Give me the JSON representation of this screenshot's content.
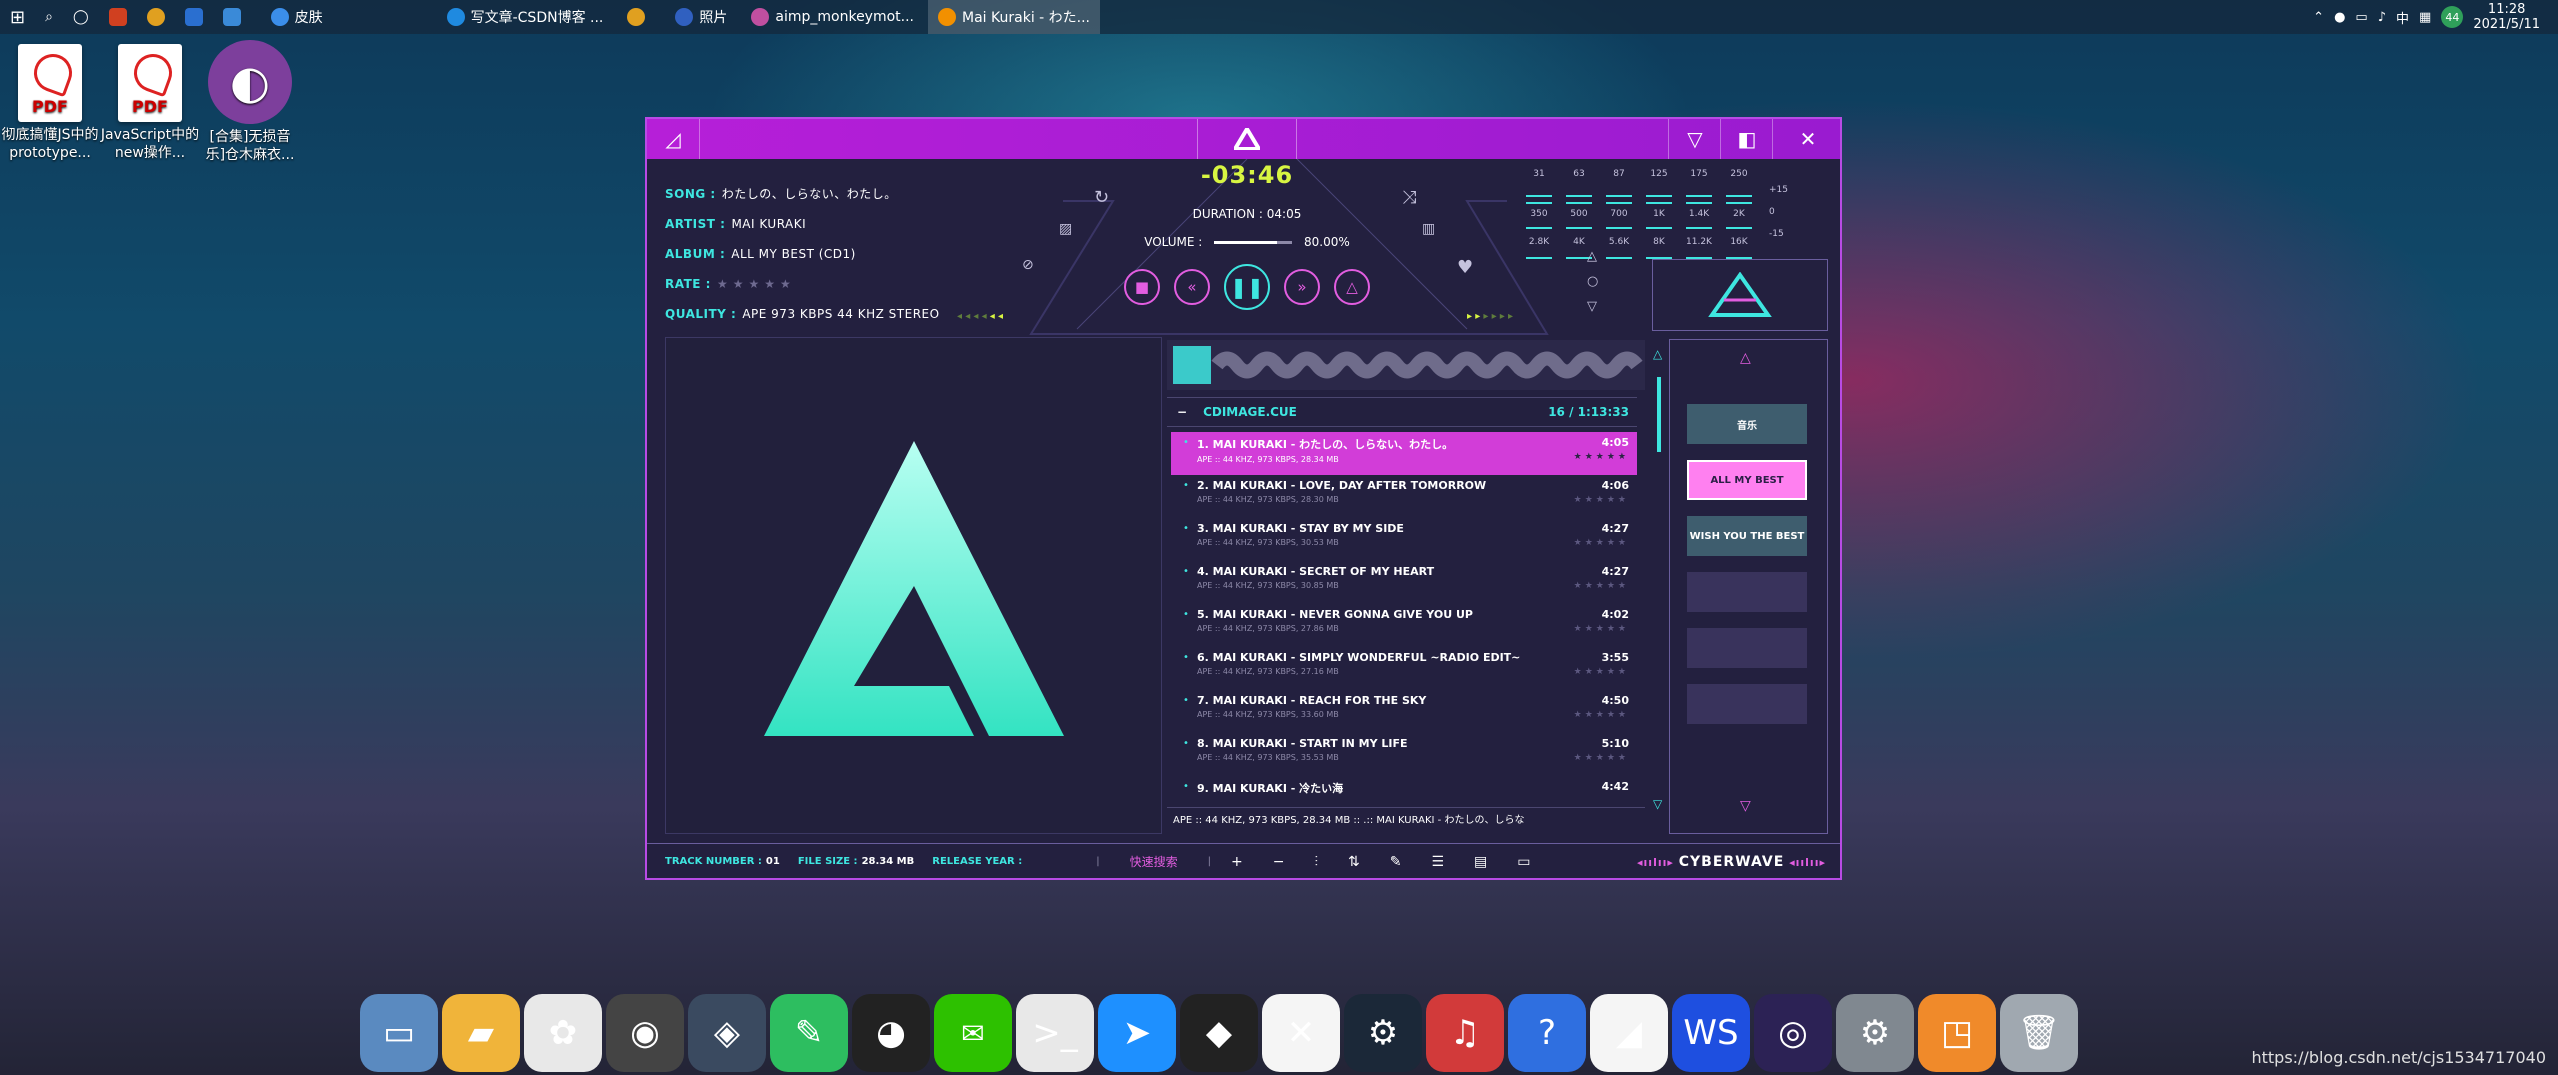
{
  "taskbar": {
    "apps": [
      {
        "label": "皮肤",
        "icon": "folder-icon",
        "color": "#3b8eea"
      },
      {
        "label": "写文章-CSDN博客 ...",
        "icon": "edge-icon",
        "color": "#1f8ae0"
      },
      {
        "label": "",
        "icon": "chrome-icon",
        "color": "#e0a020"
      },
      {
        "label": "照片",
        "icon": "photos-icon",
        "color": "#3060c0"
      },
      {
        "label": "aimp_monkeymot...",
        "icon": "image-icon",
        "color": "#c04fa0"
      },
      {
        "label": "Mai Kuraki - わた...",
        "icon": "aimp-icon",
        "color": "#f29000"
      }
    ],
    "tray": {
      "ime": "中",
      "badge": "44",
      "time": "11:28",
      "date": "2021/5/11"
    }
  },
  "desktop_icons": [
    {
      "label": "彻底搞懂JS中的prototype...",
      "type": "pdf"
    },
    {
      "label": "JavaScript中的new操作...",
      "type": "pdf"
    },
    {
      "label": "[合集]无损音乐]仓木麻衣...",
      "type": "player"
    }
  ],
  "player": {
    "song_label": "SONG :",
    "song": "わたしの、しらない、わたし。",
    "artist_label": "ARTIST :",
    "artist": "MAI KURAKI",
    "album_label": "ALBUM :",
    "album": "ALL MY BEST (CD1)",
    "rate_label": "RATE :",
    "rate_stars": "★★★★★",
    "quality_label": "QUALITY :",
    "quality": "APE 973 KBPS 44 KHZ STEREO",
    "time": "-03:46",
    "duration": "DURATION : 04:05",
    "volume_label": "VOLUME :",
    "volume_value": "80.00%",
    "volume_fraction": 0.8,
    "eq_bands": [
      "31",
      "63",
      "87",
      "125",
      "175",
      "250",
      "350",
      "500",
      "700",
      "1K",
      "1.4K",
      "2K",
      "2.8K",
      "4K",
      "5.6K",
      "8K",
      "11.2K",
      "16K"
    ],
    "eq_scale": [
      "+15",
      "0",
      "-15"
    ],
    "playlist_name": "CDIMAGE.CUE",
    "playlist_count": "16 / 1:13:33",
    "tracks": [
      {
        "title": "1. MAI KURAKI - わたしの、しらない、わたし。",
        "meta": "APE :: 44 KHZ, 973 KBPS, 28.34 MB",
        "dur": "4:05",
        "stars": "★★★★★",
        "active": true
      },
      {
        "title": "2. MAI KURAKI - LOVE, DAY AFTER TOMORROW",
        "meta": "APE :: 44 KHZ, 973 KBPS, 28.30 MB",
        "dur": "4:06",
        "stars": "★★★★★"
      },
      {
        "title": "3. MAI KURAKI - STAY BY MY SIDE",
        "meta": "APE :: 44 KHZ, 973 KBPS, 30.53 MB",
        "dur": "4:27",
        "stars": "★★★★★"
      },
      {
        "title": "4. MAI KURAKI - SECRET OF MY HEART",
        "meta": "APE :: 44 KHZ, 973 KBPS, 30.85 MB",
        "dur": "4:27",
        "stars": "★★★★★"
      },
      {
        "title": "5. MAI KURAKI - NEVER GONNA GIVE YOU UP",
        "meta": "APE :: 44 KHZ, 973 KBPS, 27.86 MB",
        "dur": "4:02",
        "stars": "★★★★★"
      },
      {
        "title": "6. MAI KURAKI - SIMPLY WONDERFUL ~RADIO EDIT~",
        "meta": "APE :: 44 KHZ, 973 KBPS, 27.16 MB",
        "dur": "3:55",
        "stars": "★★★★★"
      },
      {
        "title": "7. MAI KURAKI - REACH FOR THE SKY",
        "meta": "APE :: 44 KHZ, 973 KBPS, 33.60 MB",
        "dur": "4:50",
        "stars": "★★★★★"
      },
      {
        "title": "8. MAI KURAKI - START IN MY LIFE",
        "meta": "APE :: 44 KHZ, 973 KBPS, 35.53 MB",
        "dur": "5:10",
        "stars": "★★★★★"
      },
      {
        "title": "9. MAI KURAKI - 冷たい海",
        "meta": "",
        "dur": "4:42",
        "stars": ""
      }
    ],
    "status_line": "APE :: 44 KHZ, 973 KBPS, 28.34 MB :: .:: MAI KURAKI - わたしの、しらな",
    "playlists": [
      {
        "label": "音乐",
        "style": "teal"
      },
      {
        "label": "ALL MY BEST",
        "style": "pink"
      },
      {
        "label": "WISH YOU THE BEST",
        "style": "teal"
      },
      {
        "label": "",
        "style": "empty"
      },
      {
        "label": "",
        "style": "empty"
      },
      {
        "label": "",
        "style": "empty"
      }
    ],
    "footer": {
      "track_number_label": "TRACK NUMBER :",
      "track_number": "01",
      "file_size_label": "FILE SIZE :",
      "file_size": "28.34 MB",
      "release_year_label": "RELEASE YEAR :",
      "release_year": "",
      "search": "快速搜索",
      "skin_name": "CYBERWAVE"
    },
    "colors": {
      "accent_cyan": "#3ee6e0",
      "accent_pink": "#d23dd8",
      "title_purple": "#b61fd8",
      "time_yellow": "#d8f542"
    }
  },
  "dock": [
    {
      "icon": "finder-monitor-icon",
      "color": "#5a8ac0"
    },
    {
      "icon": "folder-icon",
      "color": "#f0b43a"
    },
    {
      "icon": "paint-icon",
      "color": "#e8e8e8"
    },
    {
      "icon": "darth-vader-icon",
      "color": "#444"
    },
    {
      "icon": "compass-icon",
      "color": "#3a4a60"
    },
    {
      "icon": "evernote-icon",
      "color": "#2dbe60"
    },
    {
      "icon": "qq-icon",
      "color": "#222"
    },
    {
      "icon": "wechat-icon",
      "color": "#2dc100"
    },
    {
      "icon": "terminal-chat-icon",
      "color": "#e8e8e8"
    },
    {
      "icon": "feishu-icon",
      "color": "#1e90ff"
    },
    {
      "icon": "nvidia-icon",
      "color": "#222"
    },
    {
      "icon": "xshell-icon",
      "color": "#f5f5f5"
    },
    {
      "icon": "steam-icon",
      "color": "#1b2838"
    },
    {
      "icon": "netease-music-icon",
      "color": "#d23a3a"
    },
    {
      "icon": "help-icon",
      "color": "#2f6fe0"
    },
    {
      "icon": "android-studio-icon",
      "color": "#f5f5f5"
    },
    {
      "icon": "webstorm-icon",
      "color": "#1e4fe0"
    },
    {
      "icon": "eclipse-icon",
      "color": "#2c2255"
    },
    {
      "icon": "settings-icon",
      "color": "#808890"
    },
    {
      "icon": "virtualbox-icon",
      "color": "#f08a2a"
    },
    {
      "icon": "trash-icon",
      "color": "#a0a8b0"
    }
  ],
  "watermark": "https://blog.csdn.net/cjs1534717040"
}
